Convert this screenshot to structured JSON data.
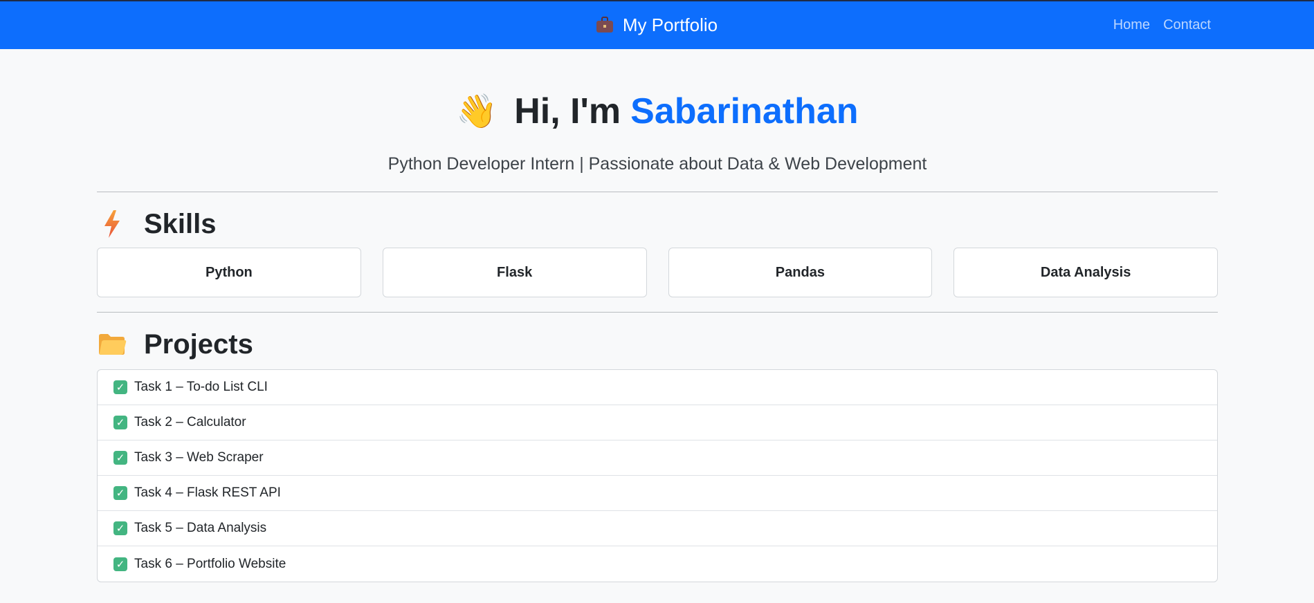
{
  "navbar": {
    "brand_icon": "briefcase-icon",
    "brand": "My Portfolio",
    "links": [
      "Home",
      "Contact"
    ],
    "bg_color": "#0d6efd"
  },
  "hero": {
    "wave_icon": "waving-hand-icon",
    "greeting": "Hi, I'm",
    "name": "Sabarinathan",
    "tagline": "Python Developer Intern | Passionate about Data & Web Development"
  },
  "skills": {
    "icon": "lightning-icon",
    "title": "Skills",
    "items": [
      "Python",
      "Flask",
      "Pandas",
      "Data Analysis"
    ]
  },
  "projects": {
    "icon": "folder-icon",
    "title": "Projects",
    "item_icon": "check-mark-icon",
    "items": [
      "Task 1 – To-do List CLI",
      "Task 2 – Calculator",
      "Task 3 – Web Scraper",
      "Task 4 – Flask REST API",
      "Task 5 – Data Analysis",
      "Task 6 – Portfolio Website"
    ]
  }
}
